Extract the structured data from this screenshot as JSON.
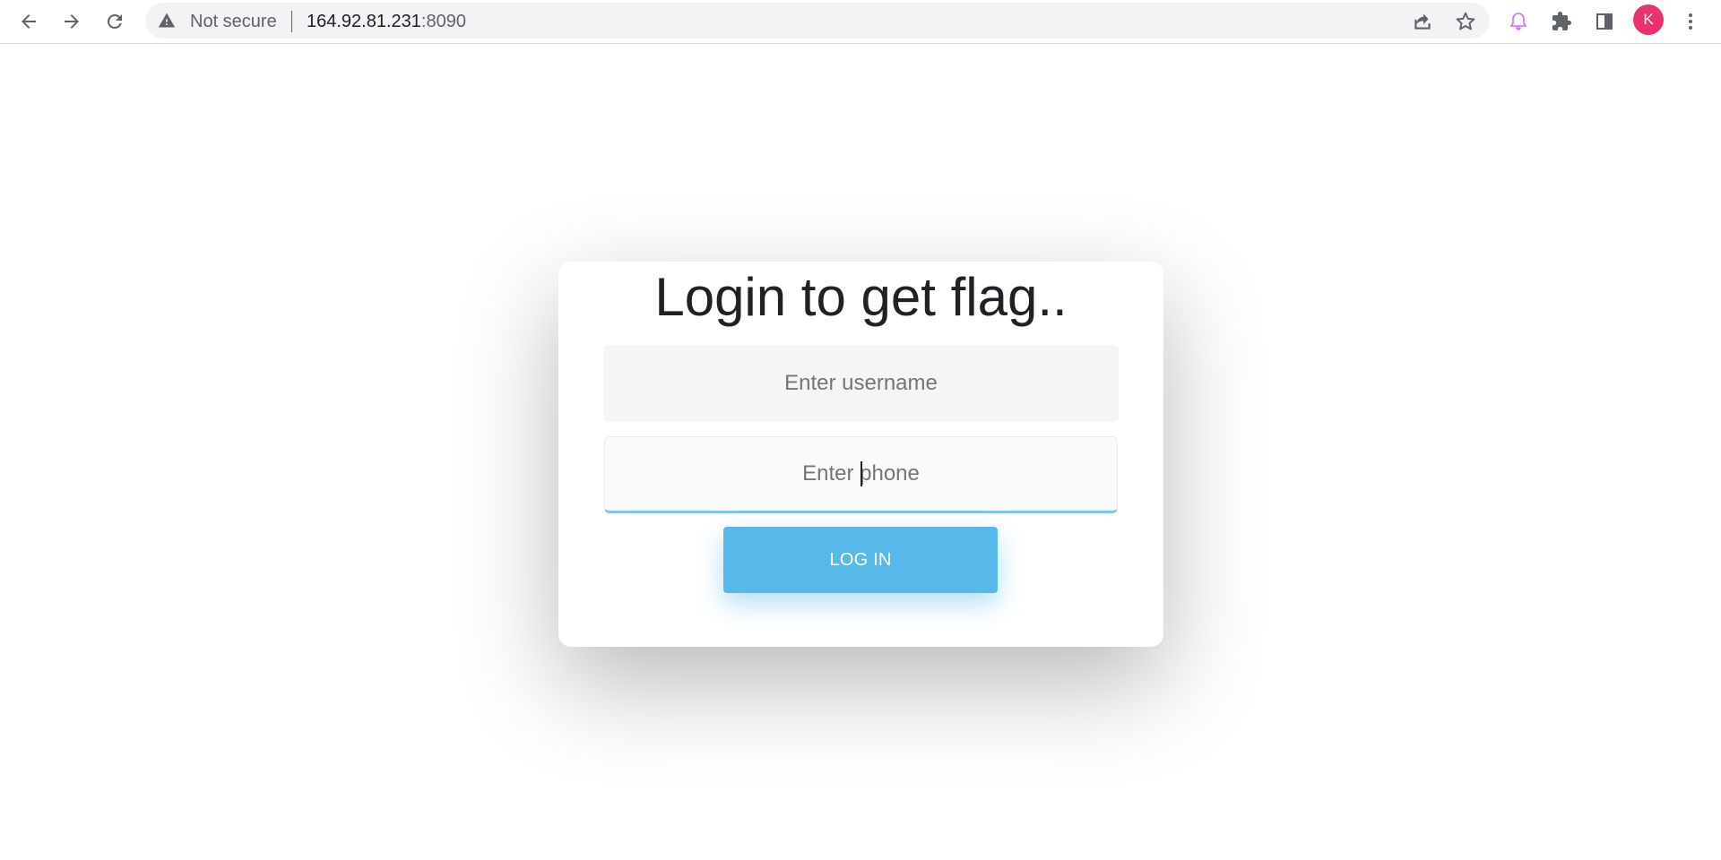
{
  "browser": {
    "security_label": "Not secure",
    "url_host": "164.92.81.231",
    "url_port": ":8090",
    "profile_initial": "K",
    "accent_profile": "#e8336e",
    "icons": [
      "back-arrow-icon",
      "forward-arrow-icon",
      "reload-icon",
      "warning-icon",
      "share-icon",
      "star-icon",
      "bell-icon",
      "puzzle-extension-icon",
      "side-panel-icon",
      "kebab-menu-icon"
    ]
  },
  "login": {
    "title": "Login to get flag..",
    "username_placeholder": "Enter username",
    "username_value": "",
    "phone_placeholder": "Enter phone",
    "phone_value": "",
    "button_label": "LOG IN",
    "button_color": "#57b9ea"
  }
}
